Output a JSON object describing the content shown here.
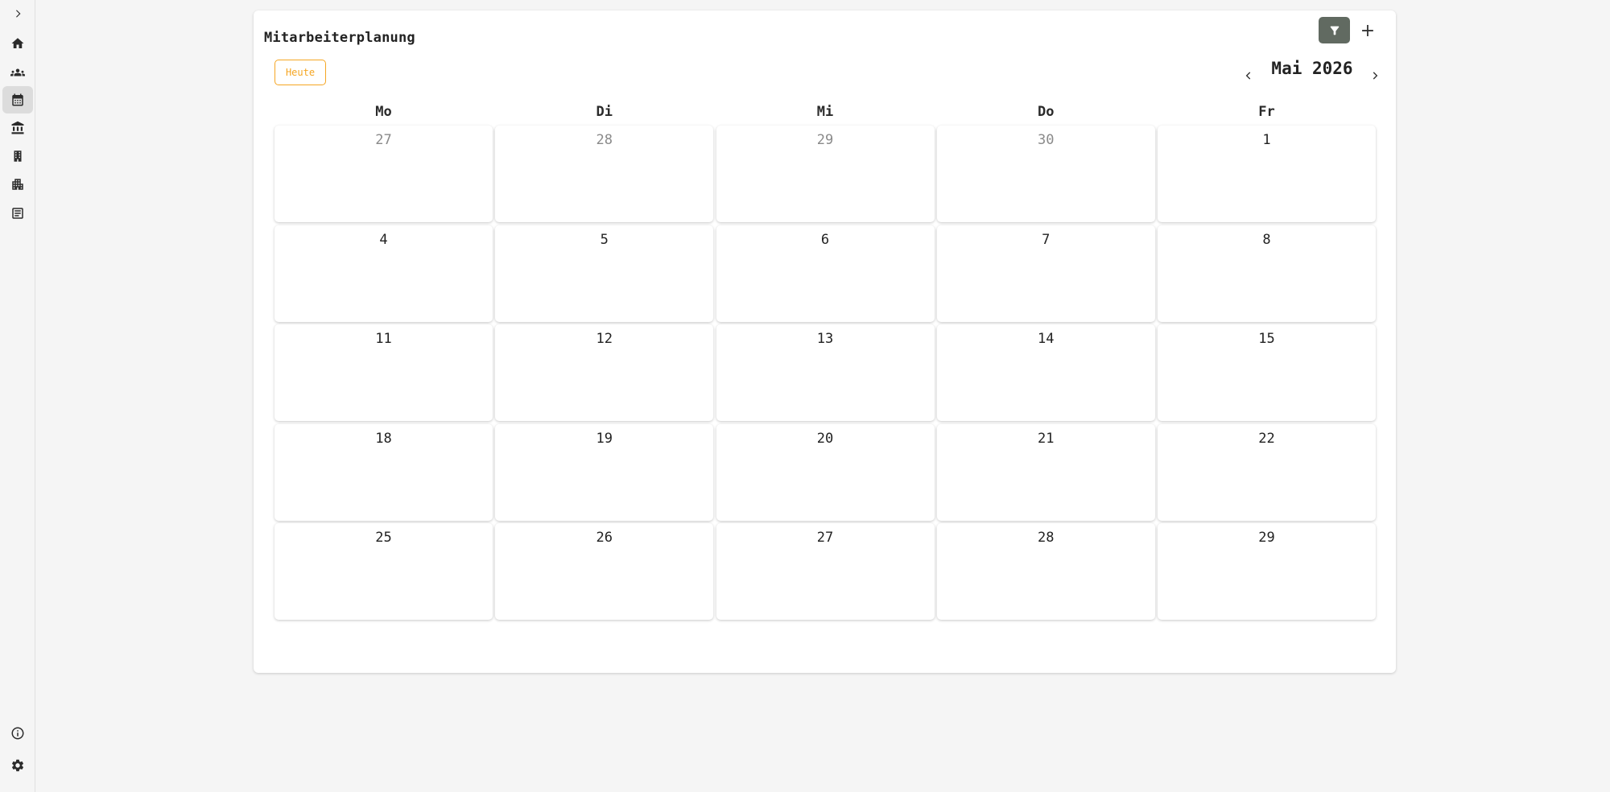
{
  "sidebar": {
    "items": [
      {
        "icon": "chevron-right-icon",
        "active": false
      },
      {
        "icon": "home-icon",
        "active": false
      },
      {
        "icon": "people-icon",
        "active": false
      },
      {
        "icon": "calendar-icon",
        "active": true
      },
      {
        "icon": "bank-icon",
        "active": false
      },
      {
        "icon": "building-icon",
        "active": false
      },
      {
        "icon": "apartment-icon",
        "active": false
      },
      {
        "icon": "receipt-icon",
        "active": false
      }
    ],
    "bottom": [
      {
        "icon": "info-icon"
      },
      {
        "icon": "gear-icon"
      }
    ]
  },
  "header": {
    "title": "Mitarbeiterplanung",
    "filter_icon": "filter-icon",
    "add_label": "+"
  },
  "toolbar": {
    "today_label": "Heute",
    "month_label": "Mai 2026"
  },
  "colors": {
    "accent": "#f5a623",
    "filter_bg": "#616a61"
  },
  "calendar": {
    "weekdays": [
      "Mo",
      "Di",
      "Mi",
      "Do",
      "Fr"
    ],
    "weeks": [
      [
        {
          "n": "27",
          "outside": true
        },
        {
          "n": "28",
          "outside": true
        },
        {
          "n": "29",
          "outside": true
        },
        {
          "n": "30",
          "outside": true
        },
        {
          "n": "1",
          "outside": false
        }
      ],
      [
        {
          "n": "4",
          "outside": false
        },
        {
          "n": "5",
          "outside": false
        },
        {
          "n": "6",
          "outside": false
        },
        {
          "n": "7",
          "outside": false
        },
        {
          "n": "8",
          "outside": false
        }
      ],
      [
        {
          "n": "11",
          "outside": false
        },
        {
          "n": "12",
          "outside": false
        },
        {
          "n": "13",
          "outside": false
        },
        {
          "n": "14",
          "outside": false
        },
        {
          "n": "15",
          "outside": false
        }
      ],
      [
        {
          "n": "18",
          "outside": false
        },
        {
          "n": "19",
          "outside": false
        },
        {
          "n": "20",
          "outside": false
        },
        {
          "n": "21",
          "outside": false
        },
        {
          "n": "22",
          "outside": false
        }
      ],
      [
        {
          "n": "25",
          "outside": false
        },
        {
          "n": "26",
          "outside": false
        },
        {
          "n": "27",
          "outside": false
        },
        {
          "n": "28",
          "outside": false
        },
        {
          "n": "29",
          "outside": false
        }
      ]
    ]
  }
}
